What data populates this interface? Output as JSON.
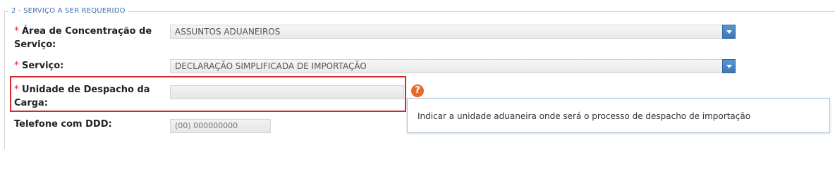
{
  "section": {
    "title": "2 - SERVIÇO A SER REQUERIDO"
  },
  "fields": {
    "area": {
      "required_mark": "*",
      "label_line1": "Área de Concentração de",
      "label_line2": "Serviço:",
      "value": "ASSUNTOS ADUANEIROS"
    },
    "servico": {
      "required_mark": "*",
      "label": "Serviço:",
      "value": "DECLARAÇÃO SIMPLIFICADA DE IMPORTAÇÃO"
    },
    "unidade": {
      "required_mark": "*",
      "label_line1": "Unidade de Despacho da",
      "label_line2": "Carga:",
      "value": ""
    },
    "telefone": {
      "label": "Telefone com DDD:",
      "value": "(00) 000000000"
    }
  },
  "help": {
    "icon": "question-icon",
    "glyph": "?",
    "tooltip": "Indicar a unidade aduaneira onde será o processo de despacho de importação"
  },
  "colors": {
    "highlight": "#d6252e",
    "required": "#d9333f",
    "legend": "#3a6ea5",
    "help_icon": "#e8692a",
    "dropdown_button": "#4a86c4"
  }
}
